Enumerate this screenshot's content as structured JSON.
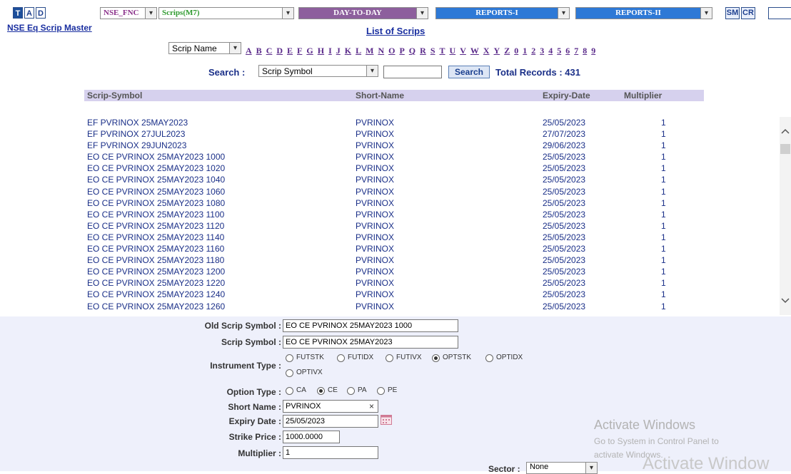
{
  "toolbar": {
    "letter_buttons": [
      "T",
      "A",
      "D"
    ],
    "exchange_select": "NSE_FNC",
    "scrips_select": "Scrips(M7)",
    "menus": [
      "DAY-TO-DAY",
      "REPORTS-I",
      "REPORTS-II"
    ],
    "sm_label": "SM",
    "cr_label": "CR"
  },
  "page": {
    "master_title": "NSE Eq Scrip Master",
    "list_title": "List of Scrips"
  },
  "filter": {
    "sort_by": "Scrip Name",
    "letters": [
      "A",
      "B",
      "C",
      "D",
      "E",
      "F",
      "G",
      "H",
      "I",
      "J",
      "K",
      "L",
      "M",
      "N",
      "O",
      "P",
      "Q",
      "R",
      "S",
      "T",
      "U",
      "V",
      "W",
      "X",
      "Y",
      "Z",
      "0",
      "1",
      "2",
      "3",
      "4",
      "5",
      "6",
      "7",
      "8",
      "9"
    ]
  },
  "search": {
    "label": "Search :",
    "field": "Scrip Symbol",
    "value": "",
    "button": "Search",
    "total": "Total Records : 431"
  },
  "table": {
    "columns": [
      "Scrip-Symbol",
      "Short-Name",
      "Expiry-Date",
      "Multiplier"
    ],
    "rows": [
      [
        "EF PVRINOX 25MAY2023",
        "PVRINOX",
        "25/05/2023",
        "1"
      ],
      [
        "EF PVRINOX 27JUL2023",
        "PVRINOX",
        "27/07/2023",
        "1"
      ],
      [
        "EF PVRINOX 29JUN2023",
        "PVRINOX",
        "29/06/2023",
        "1"
      ],
      [
        "EO CE PVRINOX 25MAY2023 1000",
        "PVRINOX",
        "25/05/2023",
        "1"
      ],
      [
        "EO CE PVRINOX 25MAY2023 1020",
        "PVRINOX",
        "25/05/2023",
        "1"
      ],
      [
        "EO CE PVRINOX 25MAY2023 1040",
        "PVRINOX",
        "25/05/2023",
        "1"
      ],
      [
        "EO CE PVRINOX 25MAY2023 1060",
        "PVRINOX",
        "25/05/2023",
        "1"
      ],
      [
        "EO CE PVRINOX 25MAY2023 1080",
        "PVRINOX",
        "25/05/2023",
        "1"
      ],
      [
        "EO CE PVRINOX 25MAY2023 1100",
        "PVRINOX",
        "25/05/2023",
        "1"
      ],
      [
        "EO CE PVRINOX 25MAY2023 1120",
        "PVRINOX",
        "25/05/2023",
        "1"
      ],
      [
        "EO CE PVRINOX 25MAY2023 1140",
        "PVRINOX",
        "25/05/2023",
        "1"
      ],
      [
        "EO CE PVRINOX 25MAY2023 1160",
        "PVRINOX",
        "25/05/2023",
        "1"
      ],
      [
        "EO CE PVRINOX 25MAY2023 1180",
        "PVRINOX",
        "25/05/2023",
        "1"
      ],
      [
        "EO CE PVRINOX 25MAY2023 1200",
        "PVRINOX",
        "25/05/2023",
        "1"
      ],
      [
        "EO CE PVRINOX 25MAY2023 1220",
        "PVRINOX",
        "25/05/2023",
        "1"
      ],
      [
        "EO CE PVRINOX 25MAY2023 1240",
        "PVRINOX",
        "25/05/2023",
        "1"
      ],
      [
        "EO CE PVRINOX 25MAY2023 1260",
        "PVRINOX",
        "25/05/2023",
        "1"
      ]
    ]
  },
  "form": {
    "old_scrip_symbol_label": "Old Scrip Symbol :",
    "old_scrip_symbol": "EO CE PVRINOX 25MAY2023 1000",
    "scrip_symbol_label": "Scrip Symbol :",
    "scrip_symbol": "EO CE PVRINOX 25MAY2023",
    "instrument_type_label": "Instrument Type :",
    "instrument_types": [
      "FUTSTK",
      "FUTIDX",
      "FUTIVX",
      "OPTSTK",
      "OPTIDX",
      "OPTIVX"
    ],
    "instrument_type_selected": "OPTSTK",
    "option_type_label": "Option Type :",
    "option_types": [
      "CA",
      "CE",
      "PA",
      "PE"
    ],
    "option_type_selected": "CE",
    "short_name_label": "Short Name :",
    "short_name": "PVRINOX",
    "expiry_date_label": "Expiry Date :",
    "expiry_date": "25/05/2023",
    "strike_price_label": "Strike Price :",
    "strike_price": "1000.0000",
    "multiplier_label": "Multiplier :",
    "multiplier": "1",
    "sector_label": "Sector :",
    "sector": "None"
  },
  "watermark": {
    "title": "Activate Windows",
    "line1": "Go to System in Control Panel to",
    "line2": "activate Windows.",
    "ghost": "Activate Window"
  },
  "colors": {
    "header_bg": "#d6d1ee",
    "row_text": "#1a2f88",
    "menu_purple": "#8d5f9d",
    "menu_blue": "#2e79d6",
    "form_bg": "#eef0fb"
  }
}
